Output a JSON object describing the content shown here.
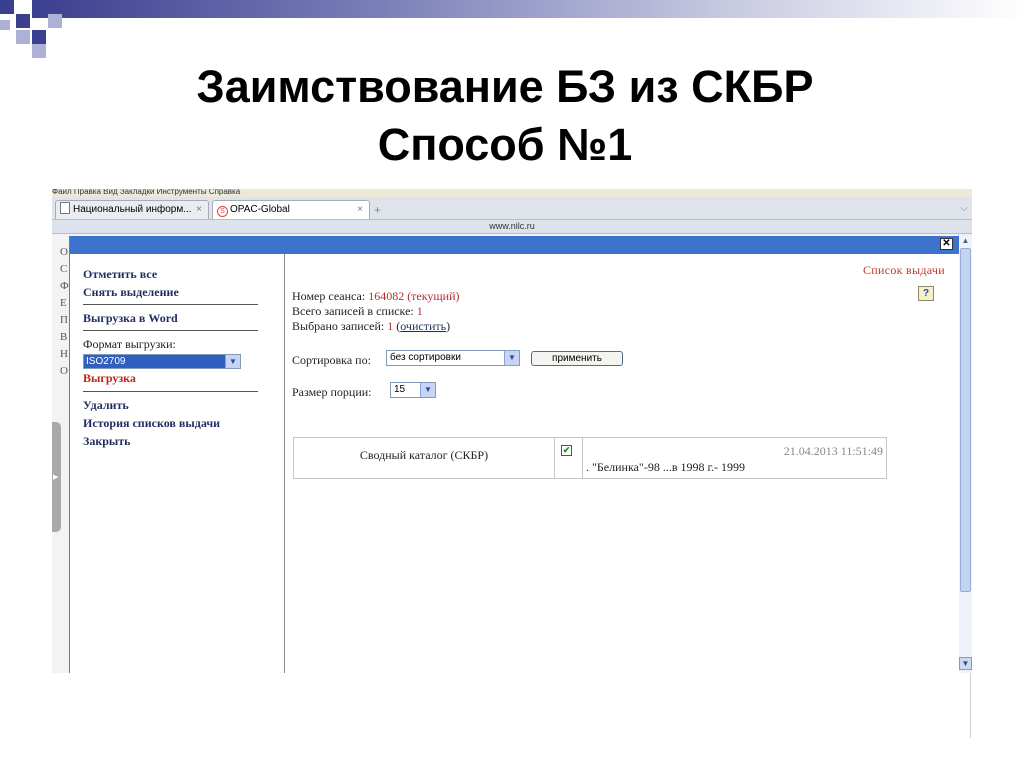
{
  "slide": {
    "title_line1": "Заимствование БЗ из СКБР",
    "title_line2": "Способ №1"
  },
  "browser": {
    "menubar_text": "Файл   Правка   Вид   Закладки   Инструменты   Справка",
    "tabs": [
      {
        "label": "Национальный информ...",
        "close": "×"
      },
      {
        "label": "OPAC-Global",
        "close": "×"
      }
    ],
    "new_tab_icon": "+",
    "tab_list_icon": "chevron-down-icon",
    "url": "www.nilc.ru",
    "bg_letters": [
      "О",
      "С",
      "Ф",
      "Е",
      "П",
      "В",
      "Н",
      "О"
    ]
  },
  "dialog": {
    "close_label": "✕",
    "left_panel": {
      "select_all": "Отметить все",
      "deselect": "Снять выделение",
      "export_word": "Выгрузка в Word",
      "format_label": "Формат выгрузки:",
      "format_value": "ISO2709",
      "export": "Выгрузка",
      "delete": "Удалить",
      "history": "История списков выдачи",
      "close": "Закрыть"
    },
    "right_panel": {
      "title": "Список выдачи",
      "session_label": "Номер сеанса:",
      "session_value": "164082 (текущий)",
      "total_label": "Всего записей в списке:",
      "total_value": "1",
      "selected_label": "Выбрано записей:",
      "selected_value": "1",
      "clear_open": "(",
      "clear_link": "очистить",
      "clear_close": ")",
      "sort_label": "Сортировка по:",
      "sort_value": "без сортировки",
      "apply_button": "применить",
      "portion_label": "Размер порции:",
      "portion_value": "15",
      "records": [
        {
          "catalog": "Сводный каталог (СКБР)",
          "checked": true,
          "date": "21.04.2013   11:51:49",
          "description": ". \"Белинка\"-98 ...в 1998 г.- 1999"
        }
      ]
    }
  }
}
